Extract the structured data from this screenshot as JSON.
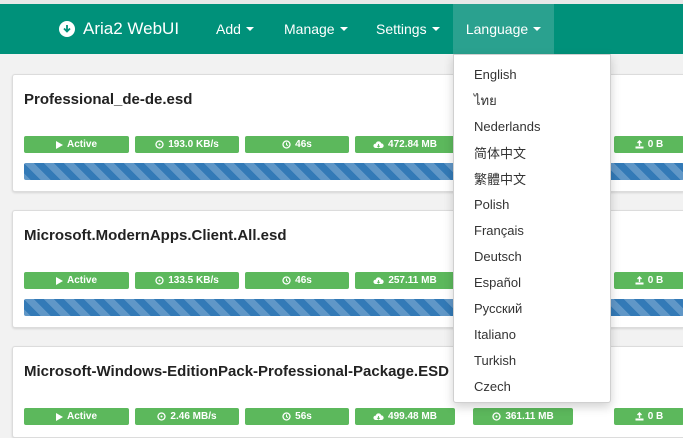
{
  "app": {
    "title": "Aria2 WebUI"
  },
  "nav": {
    "items": [
      {
        "label": "Add"
      },
      {
        "label": "Manage"
      },
      {
        "label": "Settings"
      },
      {
        "label": "Language"
      }
    ]
  },
  "language_menu": {
    "options": [
      "English",
      "ไทย",
      "Nederlands",
      "简体中文",
      "繁體中文",
      "Polish",
      "Français",
      "Deutsch",
      "Español",
      "Русский",
      "Italiano",
      "Turkish",
      "Czech"
    ]
  },
  "downloads": [
    {
      "name": "Professional_de-de.esd",
      "status": "Active",
      "speed": "193.0 KB/s",
      "eta": "46s",
      "size": "472.84 MB",
      "uploaded": "0 B"
    },
    {
      "name": "Microsoft.ModernApps.Client.All.esd",
      "status": "Active",
      "speed": "133.5 KB/s",
      "eta": "46s",
      "size": "257.11 MB",
      "uploaded": "0 B"
    },
    {
      "name": "Microsoft-Windows-EditionPack-Professional-Package.ESD",
      "status": "Active",
      "speed": "2.46 MB/s",
      "eta": "56s",
      "size": "499.48 MB",
      "downloaded": "361.11 MB",
      "uploaded": "0 B"
    }
  ],
  "colors": {
    "navbar": "#00917a",
    "stat": "#5cb85c",
    "progress": "#337ab7"
  },
  "icons": [
    "download-circle-icon",
    "play-icon",
    "speed-icon",
    "clock-icon",
    "cloud-download-icon",
    "upload-icon"
  ]
}
